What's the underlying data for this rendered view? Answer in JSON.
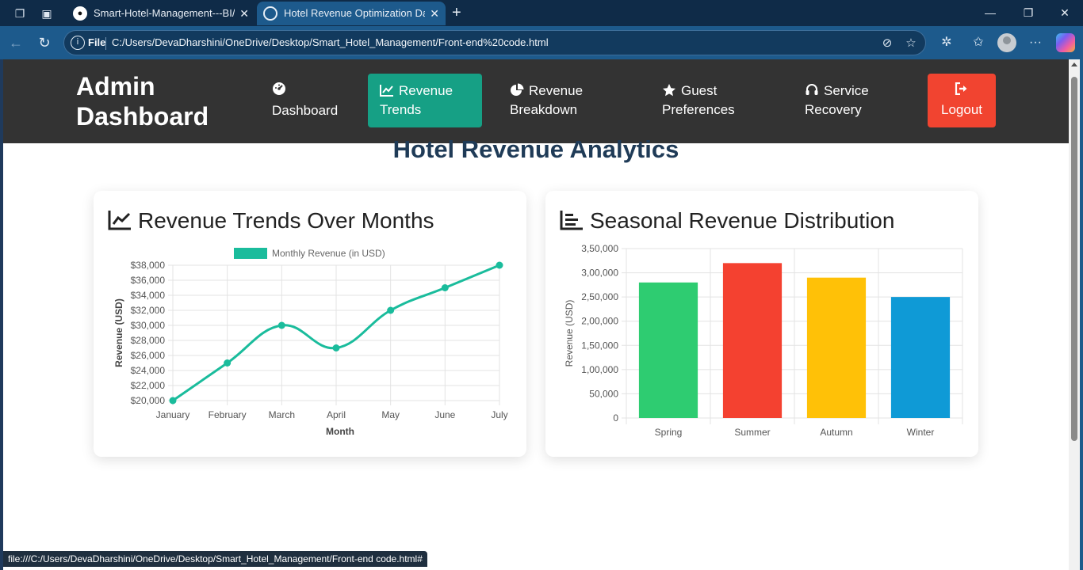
{
  "browser": {
    "tabs": [
      {
        "title": "Smart-Hotel-Management---BI/W",
        "active": false
      },
      {
        "title": "Hotel Revenue Optimization Dash",
        "active": true
      }
    ],
    "address": {
      "scheme_label": "File",
      "url": "C:/Users/DevaDharshini/OneDrive/Desktop/Smart_Hotel_Management/Front-end%20code.html"
    },
    "status_url": "file:///C:/Users/DevaDharshini/OneDrive/Desktop/Smart_Hotel_Management/Front-end code.html#"
  },
  "header": {
    "brand": "Admin Dashboard",
    "nav": [
      {
        "label": "Dashboard",
        "icon": "gauge-icon",
        "active": false
      },
      {
        "label": "Revenue Trends",
        "icon": "line-chart-icon",
        "active": true
      },
      {
        "label": "Revenue Breakdown",
        "icon": "pie-chart-icon",
        "active": false
      },
      {
        "label": "Guest Preferences",
        "icon": "star-icon",
        "active": false
      },
      {
        "label": "Service Recovery",
        "icon": "headset-icon",
        "active": false
      }
    ],
    "logout": {
      "label": "Logout",
      "icon": "sign-out-icon"
    }
  },
  "page": {
    "title": "Hotel Revenue Analytics"
  },
  "cards": {
    "trend_title": "Revenue Trends Over Months",
    "season_title": "Seasonal Revenue Distribution"
  },
  "colors": {
    "header_bg": "#333333",
    "active_nav": "#16a085",
    "logout": "#f14430",
    "line": "#1abc9c",
    "title": "#1f3b57"
  },
  "chart_data": [
    {
      "type": "line",
      "title": "",
      "legend": {
        "label": "Monthly Revenue (in USD)",
        "placement": "top"
      },
      "xlabel": "Month",
      "ylabel": "Revenue (USD)",
      "categories": [
        "January",
        "February",
        "March",
        "April",
        "May",
        "June",
        "July"
      ],
      "values": [
        20000,
        25000,
        30000,
        27000,
        32000,
        35000,
        38000
      ],
      "ylim": [
        20000,
        38000
      ],
      "yticks": [
        "$20,000",
        "$22,000",
        "$24,000",
        "$26,000",
        "$28,000",
        "$30,000",
        "$32,000",
        "$34,000",
        "$36,000",
        "$38,000"
      ],
      "color": "#1abc9c",
      "grid": true
    },
    {
      "type": "bar",
      "title": "",
      "ylabel": "Revenue (USD)",
      "categories": [
        "Spring",
        "Summer",
        "Autumn",
        "Winter"
      ],
      "values": [
        280000,
        320000,
        290000,
        250000
      ],
      "colors": [
        "#2ecc71",
        "#f44130",
        "#ffc107",
        "#0f9ad6"
      ],
      "ylim": [
        0,
        350000
      ],
      "yticks": [
        "0",
        "50,000",
        "1,00,000",
        "1,50,000",
        "2,00,000",
        "2,50,000",
        "3,00,000",
        "3,50,000"
      ],
      "grid": true
    }
  ]
}
